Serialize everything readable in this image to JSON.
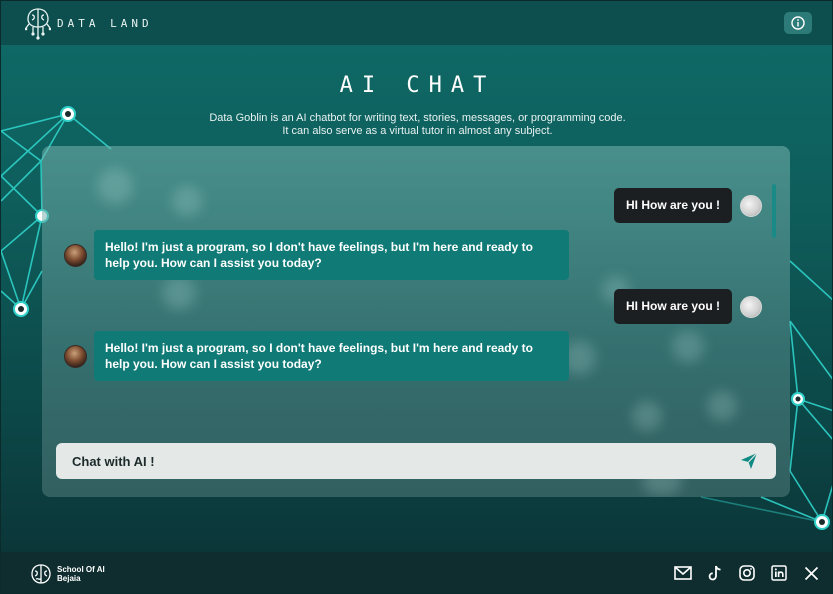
{
  "header": {
    "logo_text": "DATA LAND",
    "logo_icon": "brain-circuit-icon",
    "info_icon": "info-icon"
  },
  "hero": {
    "title": "AI CHAT",
    "subtitle_line1": "Data Goblin is an AI chatbot for writing text, stories, messages, or programming code.",
    "subtitle_line2": "It can also serve as a virtual tutor in almost any subject."
  },
  "chat": {
    "messages": [
      {
        "role": "user",
        "text": "HI How are you !"
      },
      {
        "role": "ai",
        "text": "Hello! I'm just a program, so I don't have feelings, but I'm here and ready to help you. How can I assist you today?"
      },
      {
        "role": "user",
        "text": "HI How are you !"
      },
      {
        "role": "ai",
        "text": "Hello! I'm just a program, so I don't have feelings, but I'm here and ready to help you. How can I assist you today?"
      }
    ],
    "input_placeholder": "Chat with AI !",
    "send_icon": "send-icon"
  },
  "footer": {
    "logo_line1": "School Of AI",
    "logo_line2": "Bejaia",
    "socials": [
      "mail-icon",
      "tiktok-icon",
      "instagram-icon",
      "linkedin-icon",
      "x-icon"
    ]
  },
  "colors": {
    "accent": "#0f7a76",
    "header_bg": "#0d4f4e",
    "footer_bg": "#0f2d2f",
    "user_bubble": "#1c1f22",
    "network_line": "#2fd1c9"
  }
}
